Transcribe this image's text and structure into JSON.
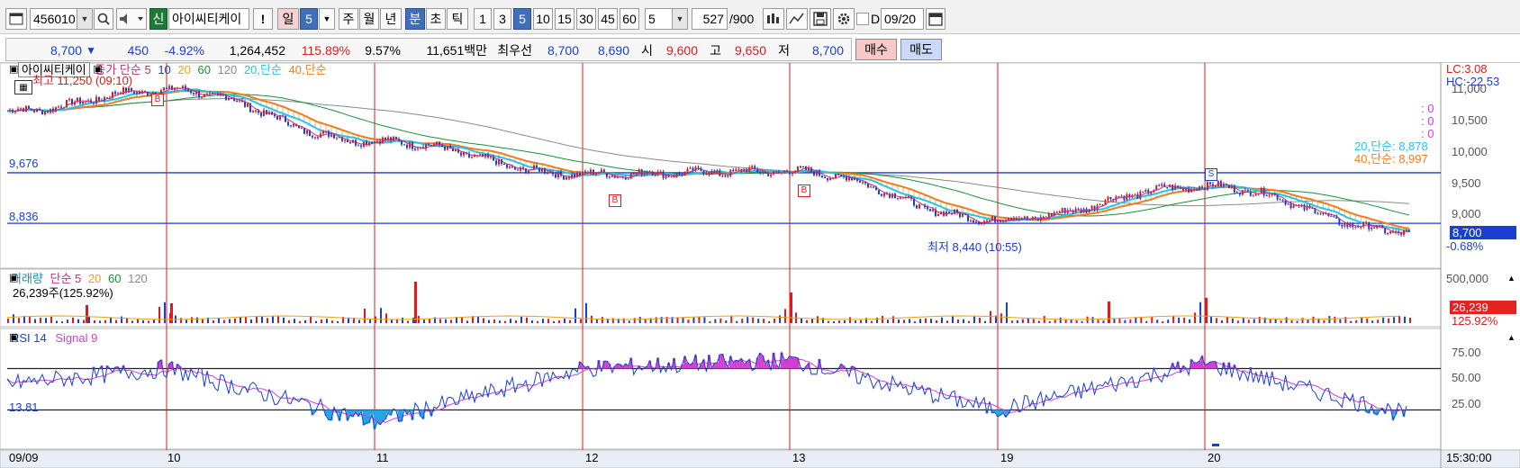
{
  "toolbar": {
    "code": "456010",
    "credit_badge": "신",
    "stock_name": "아이씨티케이",
    "alert_mark": "!",
    "period_day": "일",
    "period_day_value": "5",
    "period_week": "주",
    "period_month": "월",
    "period_year": "년",
    "period_minute": "분",
    "period_second": "초",
    "period_tick": "틱",
    "intervals": [
      "1",
      "3",
      "5",
      "10",
      "15",
      "30",
      "45",
      "60"
    ],
    "interval_value": "5",
    "count_value": "527",
    "count_total": "/900",
    "date_check_label": "D",
    "date_value": "09/20"
  },
  "quote": {
    "price": "8,700",
    "change_arrow": "▼",
    "change": "450",
    "change_pct": "-4.92%",
    "volume": "1,264,452",
    "volume_ratio": "115.89%",
    "turnover": "9.57%",
    "amount": "11,651백만",
    "best_label": "최우선",
    "best_ask": "8,700",
    "best_bid": "8,690",
    "open_label": "시",
    "open": "9,600",
    "high_label": "고",
    "high": "9,650",
    "low_label": "저",
    "low": "8,700",
    "buy_label": "매수",
    "sell_label": "매도"
  },
  "price_panel": {
    "stock_name": "아이씨티케이",
    "legend_price_ma": "종가 단순 5",
    "legend_ma": [
      "10",
      "20",
      "60",
      "120"
    ],
    "legend_ma20": "20,단순",
    "legend_ma40": "40,단순",
    "high_note": "최고 11,250 (09:10)",
    "low_note": "최저 8,440 (10:55)",
    "hline_upper": "9,676",
    "hline_lower": "8,836",
    "lc": "LC:3.08",
    "hc": "HC:-22.53",
    "zeros": [
      ": 0",
      ": 0",
      ": 0"
    ],
    "ma20_value": "20,단순: 8,878",
    "ma40_value": "40,단순: 8,997",
    "axis": [
      "11,000",
      "10,500",
      "10,000",
      "9,500",
      "9,000"
    ],
    "current_price": "8,700",
    "current_pct": "-0.68%",
    "buy_signal": "B",
    "sell_signal": "S"
  },
  "volume_panel": {
    "title": "거래량",
    "legend": "단순 5",
    "legend_ma": [
      "20",
      "60",
      "120"
    ],
    "current": "26,239주(125.92%)",
    "axis_top": "500,000",
    "current_value": "26,239",
    "current_pct": "125.92%"
  },
  "rsi_panel": {
    "title": "RSI 14",
    "signal": "Signal 9",
    "current": "13.81",
    "axis": [
      "75.00",
      "50.00",
      "25.00"
    ]
  },
  "time_axis": {
    "labels": [
      "09/09",
      "10",
      "11",
      "12",
      "13",
      "19",
      "20"
    ],
    "end_time": "15:30:00"
  },
  "colors": {
    "candle_up": "#d91c1c",
    "candle_down": "#1a3fcf",
    "ma5": "#c0307c",
    "ma10": "#1a3fcf",
    "ma20": "#22c6e6",
    "ma40": "#f07c1c",
    "ma60": "#1a8f3a",
    "ma120": "#8a8a8a",
    "rsi": "#1a3fcf",
    "signal": "#d23fd0",
    "day_divider": "#d91c1c"
  },
  "chart_data": {
    "type": "line",
    "x": [
      "09/09",
      "10",
      "11",
      "12",
      "13",
      "19",
      "20"
    ],
    "series": [
      {
        "name": "종가",
        "values": [
          10700,
          11050,
          10200,
          9650,
          9700,
          8900,
          9450,
          8700
        ]
      },
      {
        "name": "RSI 14",
        "values": [
          55,
          70,
          18,
          70,
          78,
          30,
          75,
          25
        ]
      }
    ],
    "ylim": [
      8300,
      11200
    ]
  }
}
